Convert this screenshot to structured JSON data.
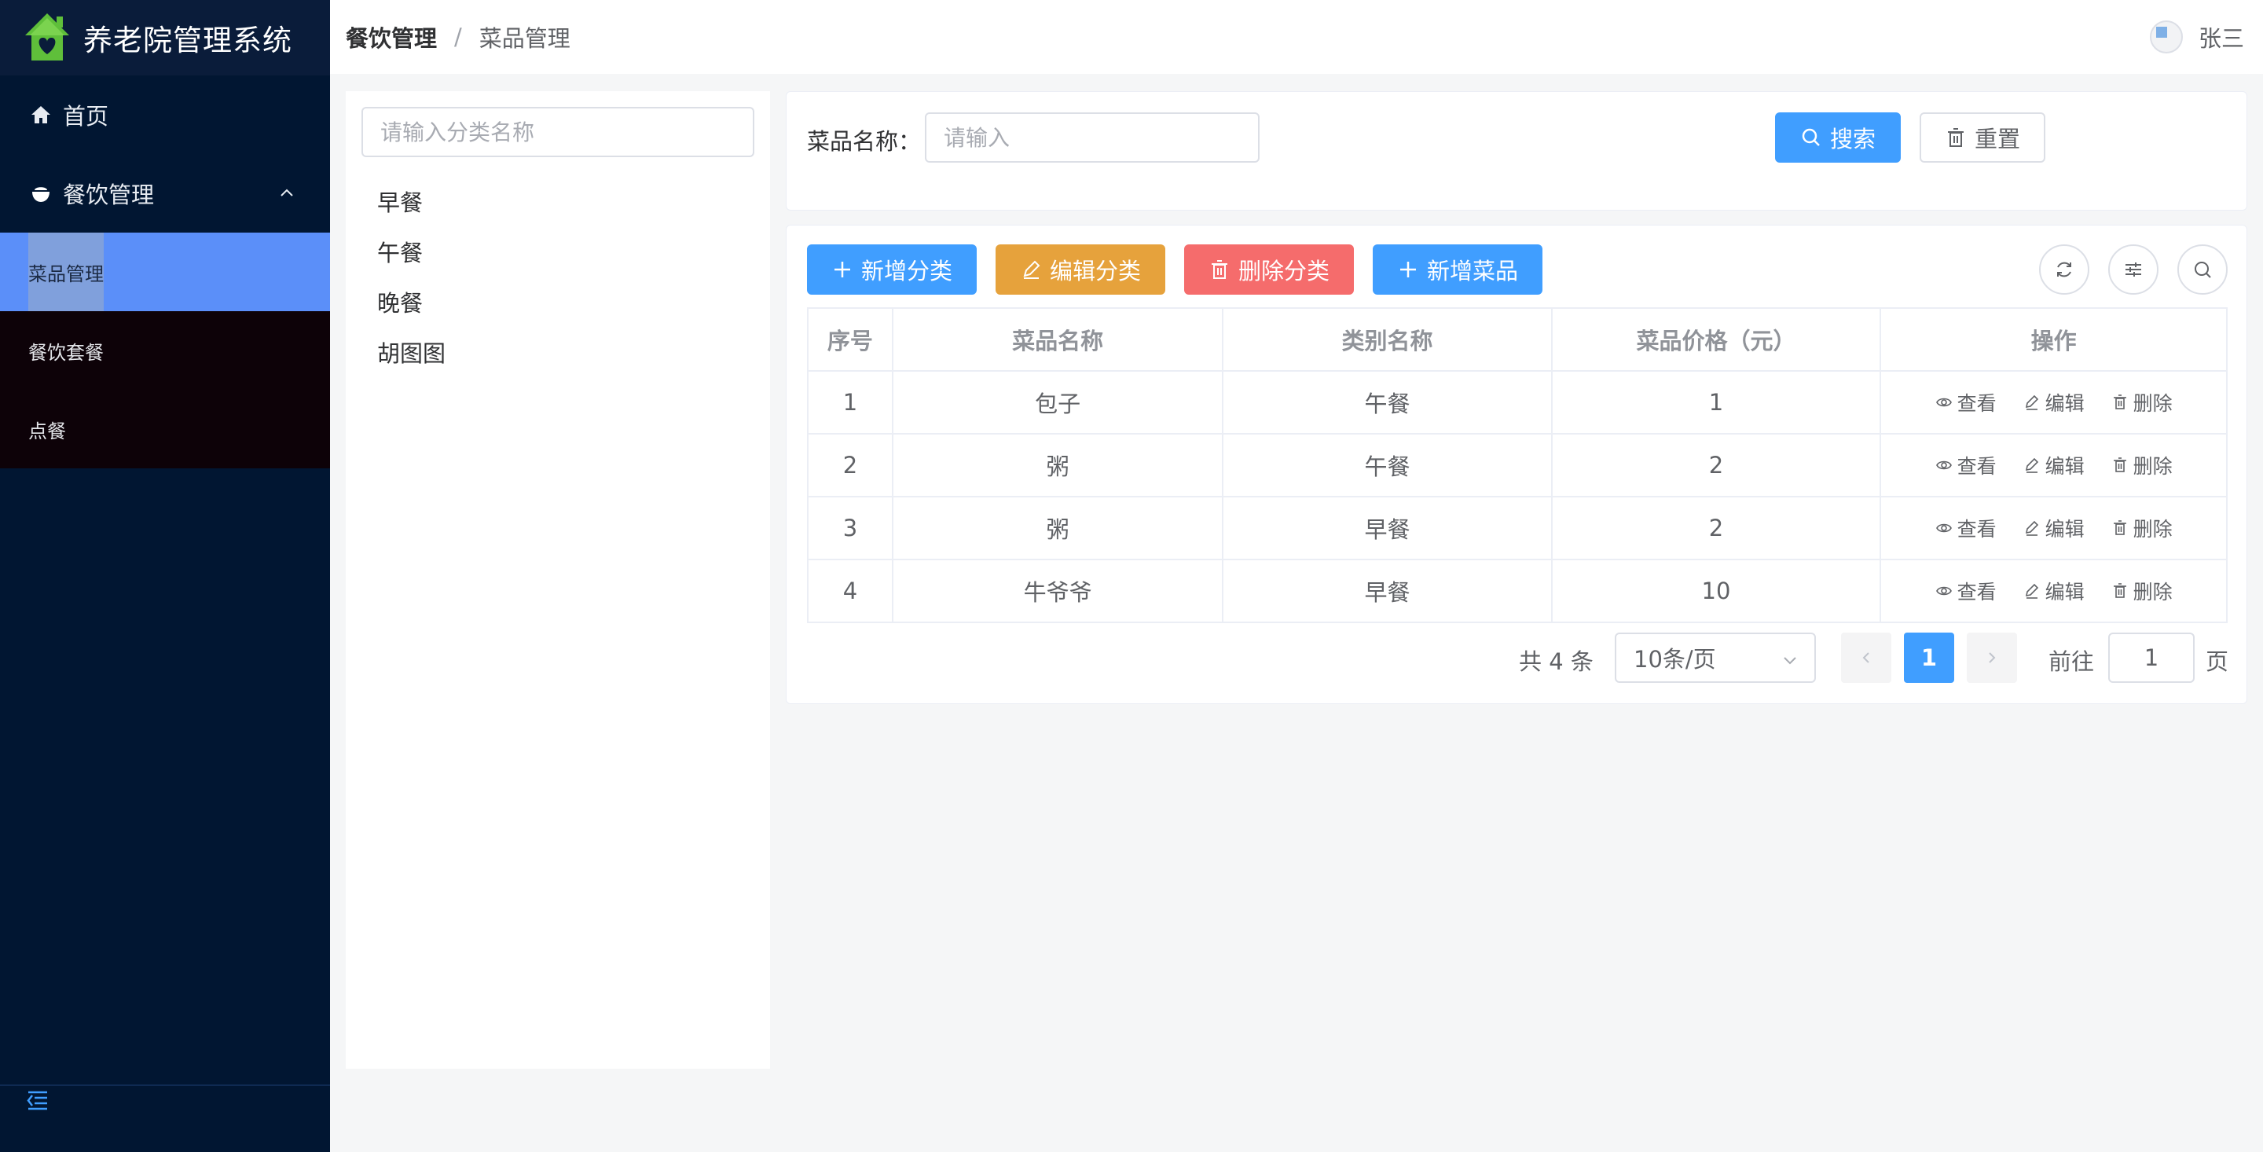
{
  "app": {
    "title": "养老院管理系统"
  },
  "sidebar": {
    "home": "首页",
    "group": "餐饮管理",
    "items": [
      "菜品管理",
      "餐饮套餐",
      "点餐"
    ]
  },
  "header": {
    "breadcrumb": [
      "餐饮管理",
      "菜品管理"
    ],
    "separator": "/",
    "user": "张三"
  },
  "categories": {
    "placeholder": "请输入分类名称",
    "items": [
      "早餐",
      "午餐",
      "晚餐",
      "胡图图"
    ]
  },
  "search": {
    "label": "菜品名称：",
    "placeholder": "请输入",
    "search_btn": "搜索",
    "reset_btn": "重置"
  },
  "toolbar": {
    "add_category": "新增分类",
    "edit_category": "编辑分类",
    "delete_category": "删除分类",
    "add_dish": "新增菜品"
  },
  "table": {
    "headers": [
      "序号",
      "菜品名称",
      "类别名称",
      "菜品价格（元）",
      "操作"
    ],
    "rows": [
      [
        "1",
        "包子",
        "午餐",
        "1"
      ],
      [
        "2",
        "粥",
        "午餐",
        "2"
      ],
      [
        "3",
        "粥",
        "早餐",
        "2"
      ],
      [
        "4",
        "牛爷爷",
        "早餐",
        "10"
      ]
    ],
    "ops": {
      "view": "查看",
      "edit": "编辑",
      "delete": "删除"
    }
  },
  "pager": {
    "total": "共 4 条",
    "page_size": "10条/页",
    "current": "1",
    "goto_label": "前往",
    "goto_value": "1",
    "goto_unit": "页"
  },
  "colors": {
    "primary": "#409eff",
    "warning": "#e6a23c",
    "danger": "#f56c6c",
    "sidebar": "#011632"
  }
}
